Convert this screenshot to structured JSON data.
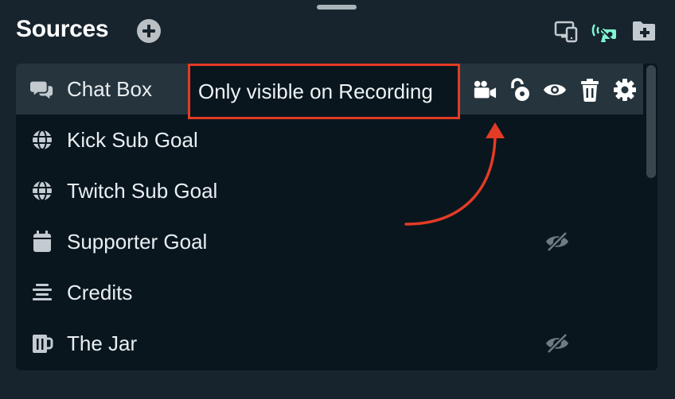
{
  "header": {
    "title": "Sources",
    "icons": [
      "add-circle-icon",
      "dual-output-devices-icon",
      "broadcast-icon",
      "add-folder-icon"
    ]
  },
  "sources": [
    {
      "name": "Chat Box",
      "icon": "chat-bubbles-icon",
      "selected": true,
      "hidden": false
    },
    {
      "name": "Kick Sub Goal",
      "icon": "globe-icon",
      "selected": false,
      "hidden": false
    },
    {
      "name": "Twitch Sub Goal",
      "icon": "globe-icon",
      "selected": false,
      "hidden": false
    },
    {
      "name": "Supporter Goal",
      "icon": "calendar-icon",
      "selected": false,
      "hidden": true
    },
    {
      "name": "Credits",
      "icon": "align-center-icon",
      "selected": false,
      "hidden": false
    },
    {
      "name": "The Jar",
      "icon": "mug-icon",
      "selected": false,
      "hidden": true
    }
  ],
  "selected_actions": [
    "recording-camera-icon",
    "unlock-icon",
    "eye-icon",
    "trash-icon",
    "gear-icon"
  ],
  "tooltip": {
    "text": "Only visible on Recording"
  },
  "colors": {
    "accent": "#80f5d2",
    "annotation": "#e33b24",
    "panel": "#09161e",
    "selected_row": "#25343d"
  }
}
